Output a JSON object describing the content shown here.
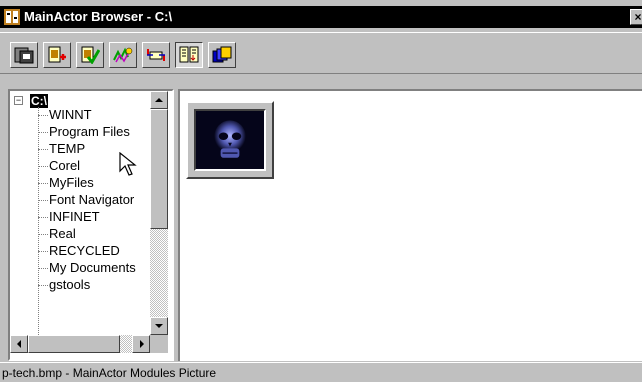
{
  "window": {
    "title": "MainActor Browser - C:\\",
    "close_label": "×"
  },
  "toolbar": {
    "buttons": [
      {
        "icon": "drive-icon"
      },
      {
        "icon": "new-document-icon"
      },
      {
        "icon": "check-document-icon"
      },
      {
        "icon": "effects-icon"
      },
      {
        "icon": "convert-icon"
      },
      {
        "icon": "details-view-icon",
        "pressed": true
      },
      {
        "icon": "thumbnail-view-icon"
      }
    ]
  },
  "tree": {
    "root_label": "C:\\",
    "expander": "−",
    "items": [
      "WINNT",
      "Program Files",
      "TEMP",
      "Corel",
      "MyFiles",
      "Font Navigator",
      "INFINET",
      "Real",
      "RECYCLED",
      "My Documents",
      "gstools"
    ]
  },
  "file_pane": {
    "items": [
      {
        "name": "p-tech.bmp",
        "icon": "skull-image-thumbnail",
        "selected": true
      }
    ]
  },
  "status": {
    "text": "p-tech.bmp - MainActor Modules Picture"
  }
}
